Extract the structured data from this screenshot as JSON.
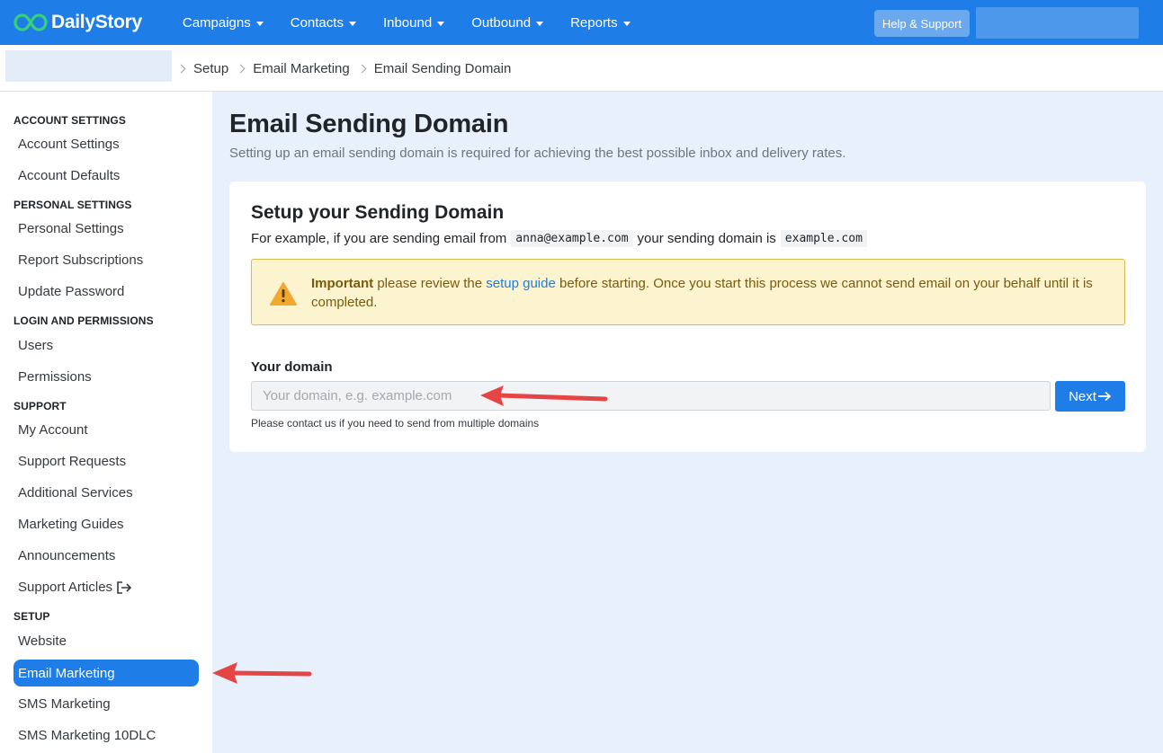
{
  "brand": {
    "name": "DailyStory",
    "color": "#1e7de6"
  },
  "nav": {
    "items": [
      {
        "label": "Campaigns"
      },
      {
        "label": "Contacts"
      },
      {
        "label": "Inbound"
      },
      {
        "label": "Outbound"
      },
      {
        "label": "Reports"
      }
    ],
    "help_label": "Help & Support"
  },
  "breadcrumb": [
    "Setup",
    "Email Marketing",
    "Email Sending Domain"
  ],
  "sidebar": {
    "sections": [
      {
        "heading": "ACCOUNT SETTINGS",
        "items": [
          "Account Settings",
          "Account Defaults"
        ]
      },
      {
        "heading": "PERSONAL SETTINGS",
        "items": [
          "Personal Settings",
          "Report Subscriptions",
          "Update Password"
        ]
      },
      {
        "heading": "LOGIN AND PERMISSIONS",
        "items": [
          "Users",
          "Permissions"
        ]
      },
      {
        "heading": "SUPPORT",
        "items": [
          "My Account",
          "Support Requests",
          "Additional Services",
          "Marketing Guides",
          "Announcements",
          "Support Articles"
        ]
      },
      {
        "heading": "SETUP",
        "items": [
          "Website",
          "Email Marketing",
          "SMS Marketing",
          "SMS Marketing 10DLC"
        ]
      }
    ],
    "active_item": "Email Marketing"
  },
  "page": {
    "title": "Email Sending Domain",
    "subtitle": "Setting up an email sending domain is required for achieving the best possible inbox and delivery rates."
  },
  "card": {
    "title": "Setup your Sending Domain",
    "example_prefix": "For example, if you are sending email from",
    "example_email": "anna@example.com",
    "example_middle": "your sending domain is",
    "example_domain": "example.com",
    "alert": {
      "strong": "Important",
      "text_before_link": "please review the",
      "link": "setup guide",
      "text_after_link": "before starting. Once you start this process we cannot send email on your behalf until it is completed."
    },
    "domain_label": "Your domain",
    "domain_placeholder": "Your domain, e.g. example.com",
    "domain_value": "",
    "next_label": "Next",
    "help_text": "Please contact us if you need to send from multiple domains"
  }
}
